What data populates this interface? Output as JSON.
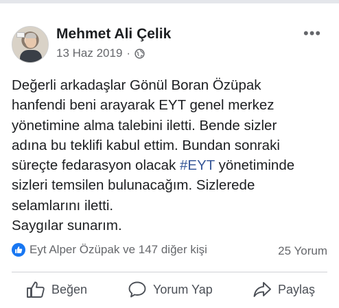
{
  "post": {
    "author": "Mehmet Ali Çelik",
    "date": "13 Haz 2019",
    "separator": "·",
    "privacy_icon": "globe-icon",
    "more_icon": "more-options-icon",
    "more_label": "•••",
    "lines": [
      "Değerli arkadaşlar Gönül Boran Özüpak",
      "hanfendi beni arayarak EYT genel merkez",
      "yönetimine alma talebini iletti. Bende sizler",
      "adına bu teklifi kabul ettim. Bundan sonraki",
      "süreçte fedarasyon olacak ",
      "sizleri temsilen bulunacağım. Sizlerede",
      "selamlarını iletti.",
      "Saygılar sunarım."
    ],
    "hashtag": "#EYT",
    "line5_tail": " yönetiminde"
  },
  "stats": {
    "reactions_text": "Eyt Alper Özüpak ve 147 diğer kişi",
    "comments_text": "25 Yorum"
  },
  "actions": {
    "like": "Beğen",
    "comment": "Yorum Yap",
    "share": "Paylaş"
  },
  "colors": {
    "accent": "#1877f2",
    "hashtag": "#385898",
    "secondary_text": "#65676b"
  }
}
